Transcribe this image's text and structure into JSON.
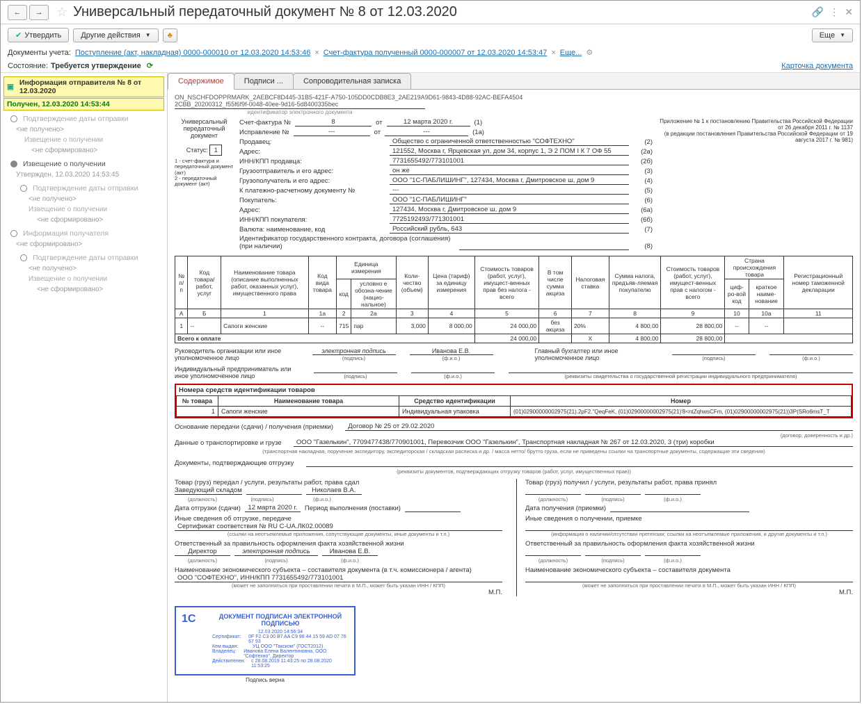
{
  "title": "Универсальный передаточный документ № 8 от 12.03.2020",
  "toolbar": {
    "approve": "Утвердить",
    "other_actions": "Другие действия",
    "more": "Еще"
  },
  "doc_bar": {
    "label": "Документы учета:",
    "link1": "Поступление (акт, накладная) 0000-000010 от 12.03.2020 14:53:46",
    "link2": "Счет-фактура полученный 0000-000007 от 12.03.2020 14:53:47",
    "more": "Еще..."
  },
  "state": {
    "label": "Состояние:",
    "value": "Требуется утверждение",
    "card": "Карточка документа"
  },
  "sidebar": {
    "hl_title": "Информация отправителя № 8 от 12.03.2020",
    "hl_status": "Получен, 12.03.2020 14:53:44",
    "s1": "Подтверждение даты отправки",
    "s1_sub": "<не получено>",
    "s1_item": "Извещение о получении",
    "s1_item_sub": "<не сформировано>",
    "s2": "Извещение о получении",
    "s2_sub": "Утвержден, 12.03.2020 14:53:45",
    "s2a": "Подтверждение даты отправки",
    "s2a_sub": "<не получено>",
    "s2b": "Извещение о получении",
    "s2b_sub": "<не сформировано>",
    "s3": "Информация получателя",
    "s3_sub": "<не сформировано>",
    "s3a": "Подтверждение даты отправки",
    "s3a_sub": "<не получено>",
    "s3b": "Извещение о получении",
    "s3b_sub": "<не сформировано>"
  },
  "tabs": {
    "t1": "Содержимое",
    "t2": "Подписи ...",
    "t3": "Сопроводительная записка"
  },
  "doc": {
    "id1": "ON_NSCHFDOPPRMARK_2AEBCF8D445-31B5-421F-A750-105DD0CDB8E3_2AE219A9D61-9843-4D88-92AC-BEFA4504",
    "id2": "2CBB_20200312_f55f6f9f-0048-40ee-9d16-5d8400335bec",
    "id_cap": "идентификатор электронного документа",
    "upd_label": "Универсальный передаточный документ",
    "status_label": "Статус:",
    "status_val": "1",
    "legend": "1 - счет-фактура и передаточный документ (акт)\n2 - передаточный документ (акт)",
    "right_note": "Приложение № 1 к постановлению Правительства Российской Федерации от 26 декабря 2011 г. № 1137\n(в редакции постановления Правительства Российской Федерации от 19 августа 2017 г. № 981)",
    "rows": {
      "r1_l": "Счет-фактура №",
      "r1_v1": "8",
      "r1_m": "от",
      "r1_v2": "12 марта 2020 г.",
      "r1_n": "(1)",
      "r2_l": "Исправление №",
      "r2_v1": "---",
      "r2_m": "от",
      "r2_v2": "---",
      "r2_n": "(1а)",
      "r3_l": "Продавец:",
      "r3_v": "Общество с ограниченной ответственностью \"СОФТЕХНО\"",
      "r3_n": "(2)",
      "r4_l": "Адрес:",
      "r4_v": "121552, Москва г, Ярцевская ул, дом 34, корпус 1, Э 2 ПОМ I К 7 ОФ 55",
      "r4_n": "(2а)",
      "r5_l": "ИНН/КПП продавца:",
      "r5_v": "7731655492/773101001",
      "r5_n": "(2б)",
      "r6_l": "Грузоотправитель и его адрес:",
      "r6_v": "он же",
      "r6_n": "(3)",
      "r7_l": "Грузополучатель и его адрес:",
      "r7_v": "ООО \"1С-ПАБЛИШИНГ\", 127434, Москва г, Дмитровское ш, дом 9",
      "r7_n": "(4)",
      "r8_l": "К платежно-расчетному документу №",
      "r8_v": "---",
      "r8_n": "(5)",
      "r9_l": "Покупатель:",
      "r9_v": "ООО \"1С-ПАБЛИШИНГ\"",
      "r9_n": "(6)",
      "r10_l": "Адрес:",
      "r10_v": "127434, Москва г, Дмитровское ш, дом 9",
      "r10_n": "(6а)",
      "r11_l": "ИНН/КПП покупателя:",
      "r11_v": "7725192493/771301001",
      "r11_n": "(6б)",
      "r12_l": "Валюта: наименование, код",
      "r12_v": "Российский рубль, 643",
      "r12_n": "(7)",
      "r13_l": "Идентификатор государственного контракта, договора (соглашения) (при наличии)",
      "r13_v": "",
      "r13_n": "(8)"
    },
    "th": {
      "c1": "№ п/п",
      "c2": "Код товара/ работ, услуг",
      "c3": "Наименование товара (описание выполненных работ, оказанных услуг), имущественного права",
      "c4": "Код вида товара",
      "c5": "Единица измерения",
      "c5a": "код",
      "c5b": "условно е обозна-чение (нацио-нальное)",
      "c6": "Коли-чество (объем)",
      "c7": "Цена (тариф) за единицу измерения",
      "c8": "Стоимость товаров (работ, услуг), имущест-венных прав без налога - всего",
      "c9": "В том числе сумма акциза",
      "c10": "Налоговая ставка",
      "c11": "Сумма налога, предъяв-ляемая покупателю",
      "c12": "Стоимость товаров (работ, услуг), имущест-венных прав с налогом - всего",
      "c13": "Страна происхождения товара",
      "c13a": "циф-ро-вой код",
      "c13b": "краткое наиме-нование",
      "c14": "Регистрационный номер таможенной декларации"
    },
    "sub": {
      "a": "А",
      "b": "Б",
      "c1": "1",
      "c1a": "1а",
      "c2": "2",
      "c2a": "2а",
      "c3": "3",
      "c4": "4",
      "c5": "5",
      "c6": "6",
      "c7": "7",
      "c8": "8",
      "c9": "9",
      "c10": "10",
      "c10a": "10а",
      "c11": "11"
    },
    "row1": {
      "n": "1",
      "code": "--",
      "name": "Сапоги женские",
      "kind": "--",
      "ucode": "715",
      "uname": "пар",
      "qty": "3,000",
      "price": "8 000,00",
      "sum": "24 000,00",
      "excise": "без акциза",
      "rate": "20%",
      "tax": "4 800,00",
      "total": "28 800,00",
      "cc": "--",
      "cn": "--",
      "decl": ""
    },
    "total": {
      "label": "Всего к оплате",
      "sum": "24 000,00",
      "x": "X",
      "tax": "4 800,00",
      "total": "28 800,00"
    },
    "sig": {
      "head_l": "Руководитель организации или иное уполномоченное лицо",
      "esig": "электронная подпись",
      "head_name": "Иванова Е.В.",
      "acc_l": "Главный бухгалтер или иное уполномоченное лицо",
      "ip_l": "Индивидуальный предприниматель или иное уполномоченное лицо",
      "cap_sig": "(подпись)",
      "cap_fio": "(ф.и.о.)",
      "ip_cap": "(реквизиты свидетельства о государственной регистрации индивидуального предпринимателя)"
    },
    "idbox": {
      "title": "Номера средств идентификации товаров",
      "h1": "№ товара",
      "h2": "Наименование товара",
      "h3": "Средство идентификации",
      "h4": "Номер",
      "r_n": "1",
      "r_name": "Сапоги женские",
      "r_means": "Индивидуальная упаковка",
      "r_num": "(01)02900000002975(21).2pF2.\"QeqFeK, (01)02900000002975(21)'8<ntZqhwsCFm, (01)02900000002975(21))3P(SRo6msT_T"
    },
    "basis": {
      "l": "Основание передачи (сдачи) / получения (приемки)",
      "v": "Договор № 25 от 29.02.2020",
      "cap": "(договор; доверенность и др.)"
    },
    "transport": {
      "l": "Данные о транспортировке и грузе",
      "v": "ООО \"Газелькин\", 7709477438/770901001, Перевозчик ООО \"Газелькин\", Транспортная накладная № 267 от 12.03.2020, 3 (три) коробки",
      "cap": "(транспортная накладная, поручение экспедитору, экспедиторская / складская расписка и др. / масса нетто/ брутто груза, если не приведены ссылки на транспортные документы, содержащие эти сведения)"
    },
    "shipdocs": {
      "l": "Документы, подтверждающие отгрузку",
      "cap": "(реквизиты документов, подтверждающих отгрузку товаров (работ, услуг, имущественных прав))"
    },
    "left": {
      "t1": "Товар (груз) передал / услуги, результаты работ, права сдал",
      "pos": "Заведующий складом",
      "name": "Николаев В.А.",
      "date_l": "Дата отгрузки (сдачи)",
      "date_v": "12 марта 2020 г.",
      "period": "Период выполнения (поставки)",
      "other": "Иные сведения об отгрузке, передаче",
      "cert": "Сертификат соответствия № RU С-UA.ЛК02.00089",
      "cert_cap": "(ссылки на неотъемлемые приложения, сопутствующие документы, иные документы и т.п.)",
      "resp": "Ответственный за правильность оформления факта хозяйственной жизни",
      "dir": "Директор",
      "dir_name": "Иванова Е.В.",
      "org": "Наименование экономического субъекта – составителя документа (в т.ч. комиссионера / агента)",
      "org_v": "ООО \"СОФТЕХНО\", ИНН/КПП 7731655492/773101001",
      "org_cap": "(может не заполняться при проставлении печати в М.П., может быть указан ИНН / КПП)",
      "mp": "М.П."
    },
    "right": {
      "t1": "Товар (груз) получил / услуги, результаты работ, права принял",
      "date_l": "Дата получения (приемки)",
      "other": "Иные сведения о получении, приемке",
      "other_cap": "(информация о наличии/отсутствии претензии; ссылки на неотъемлемые приложения, и другие  документы и т.п.)",
      "resp": "Ответственный за правильность оформления факта хозяйственной жизни",
      "org": "Наименование экономического субъекта – составителя документа",
      "org_cap": "(может не заполняться при проставлении печати в М.П., может быть указан ИНН / КПП)",
      "mp": "М.П."
    },
    "caps": {
      "pos": "(должность)",
      "sig": "(подпись)",
      "fio": "(ф.и.о.)"
    },
    "stamp": {
      "title": "ДОКУМЕНТ ПОДПИСАН ЭЛЕКТРОННОЙ ПОДПИСЬЮ",
      "date": "12.03.2020 14:56:34",
      "l1": "Сертификат:",
      "v1": "0F F2 C3 00 B7 AA C9 98 44 15 59 AD 07 76 67 93",
      "l2": "Кем выдан:",
      "v2": "УЦ ООО \"Такском\" (ГОСТ2012)",
      "l3": "Владелец:",
      "v3": "Иванова Елена Валентиновна, ООО \"Софтехно\", Директор",
      "l4": "Действителен:",
      "v4": "с 28.08.2019 11:43:25 по 28.08.2020 11:53:25",
      "verna": "Подпись верна"
    }
  }
}
